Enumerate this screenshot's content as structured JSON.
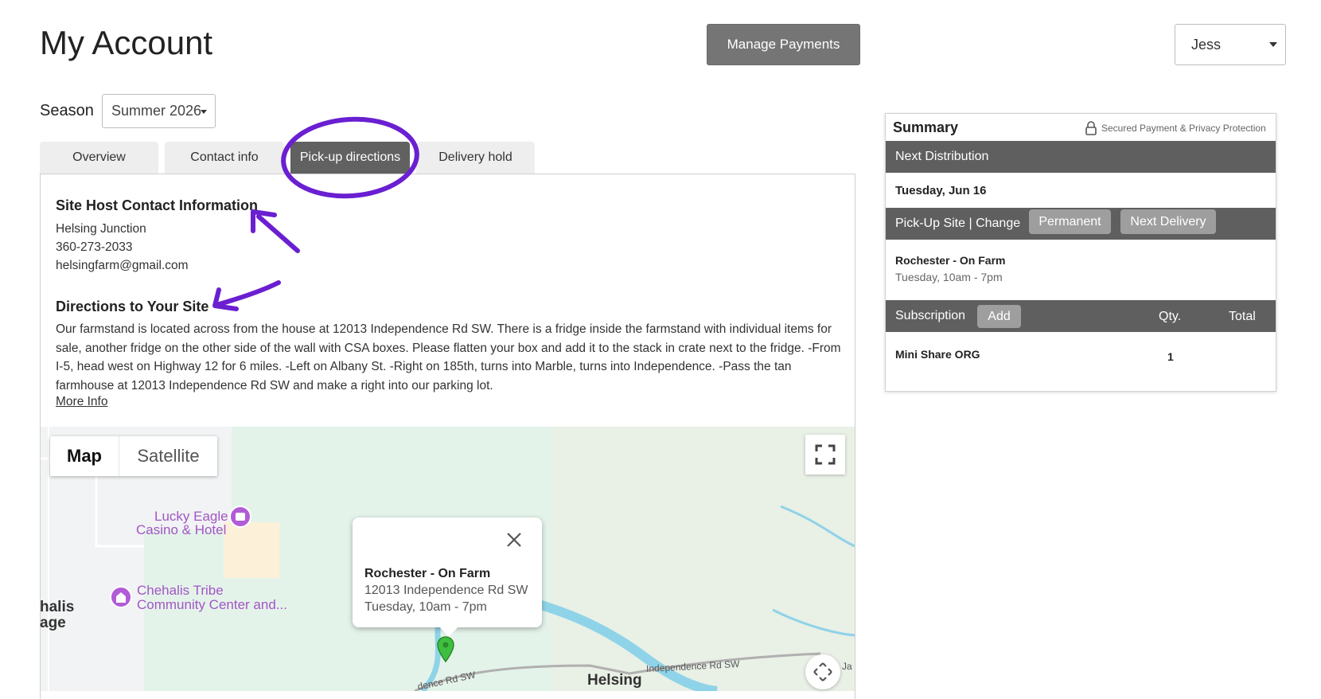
{
  "header": {
    "title": "My Account",
    "manage_payments_label": "Manage Payments",
    "user_name": "Jess"
  },
  "season": {
    "label": "Season",
    "selected": "Summer 2026"
  },
  "tabs": [
    {
      "label": "Overview",
      "active": false
    },
    {
      "label": "Contact info",
      "active": false
    },
    {
      "label": "Pick-up directions",
      "active": true
    },
    {
      "label": "Delivery hold",
      "active": false
    }
  ],
  "site_host": {
    "heading": "Site Host Contact Information",
    "name": "Helsing Junction",
    "phone": "360-273-2033",
    "email": "helsingfarm@gmail.com"
  },
  "directions": {
    "heading": "Directions to Your Site",
    "body": "Our farmstand is located across from the house at 12013 Independence Rd SW. There is a fridge inside the farmstand with individual items for sale, another fridge on the other side of the wall with CSA boxes. Please flatten your box and add it to the stack in crate next to the fridge. -From I-5, head west on Highway 12 for 6 miles. -Left on Albany St. -Right on 185th, turns into Marble, turns into Independence. -Pass the tan farmhouse at 12013 Independence Rd SW and make a right into our parking lot.",
    "more_info": "More Info"
  },
  "map": {
    "map_tab": "Map",
    "satellite_tab": "Satellite",
    "popup": {
      "title": "Rochester - On Farm",
      "address": "12013 Independence Rd SW",
      "hours": "Tuesday, 10am - 7pm"
    },
    "labels": {
      "lucky_eagle_1": "Lucky Eagle",
      "lucky_eagle_2": "Casino & Hotel",
      "chehalis_1": "Chehalis Tribe",
      "chehalis_2": "Community Center and...",
      "town_1": "halis",
      "town_2": "age",
      "helsing": "Helsing",
      "road_1": "Independence Rd SW",
      "road_2": "dence Rd SW",
      "road_3": "Ja"
    }
  },
  "summary": {
    "title": "Summary",
    "secured_text": "Secured Payment & Privacy Protection",
    "next_distribution_label": "Next Distribution",
    "next_distribution_date": "Tuesday, Jun 16",
    "pickup_label": "Pick-Up Site | Change",
    "permanent_label": "Permanent",
    "next_delivery_label": "Next Delivery",
    "site_name": "Rochester - On Farm",
    "site_hours": "Tuesday, 10am - 7pm",
    "subscription_label": "Subscription",
    "add_label": "Add",
    "qty_label": "Qty.",
    "total_label": "Total",
    "item_name": "Mini Share ORG",
    "item_qty": "1"
  },
  "colors": {
    "annotation": "#6a1fd1",
    "bar": "#5f5f5f",
    "pill": "#9e9e9e",
    "map_land": "#e4f3ea",
    "map_water": "#8fd3e8",
    "marker": "#3fbf3f"
  },
  "icons": [
    "caret-down-icon",
    "lock-icon",
    "fullscreen-icon",
    "close-icon",
    "map-marker-icon",
    "casino-icon",
    "community-center-icon",
    "move-icon"
  ]
}
